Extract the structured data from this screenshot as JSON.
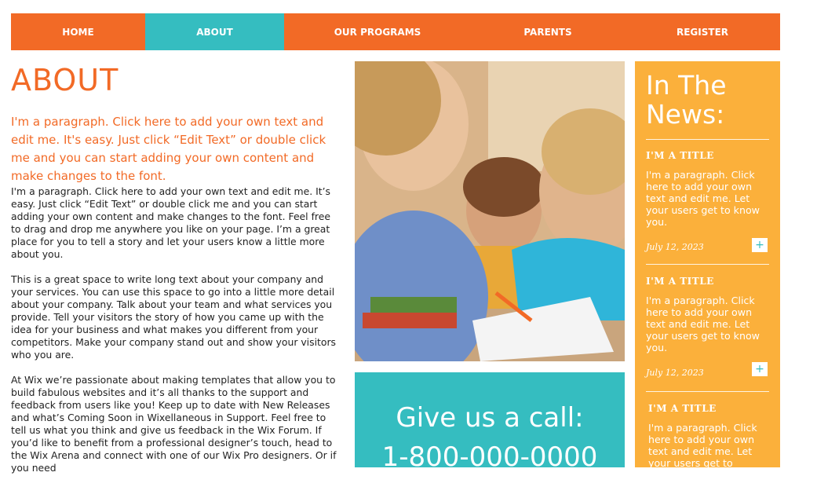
{
  "nav": {
    "items": [
      {
        "label": "HOME",
        "active": false
      },
      {
        "label": "ABOUT",
        "active": true
      },
      {
        "label": "OUR PROGRAMS",
        "active": false
      },
      {
        "label": "PARENTS",
        "active": false
      },
      {
        "label": "REGISTER",
        "active": false
      }
    ]
  },
  "about": {
    "title": "ABOUT",
    "intro": "I'm a paragraph. Click here to add your own text and edit me. It's easy. Just click “Edit Text” or double click me and you can start adding your own content and make changes to the font.",
    "paragraphs": [
      "I'm a paragraph. Click here to add your own text and edit me. It’s easy. Just click “Edit Text” or double click me and you can start adding your own content and make changes to the font. Feel free to drag and drop me anywhere you like on your page. I’m a great place for you to tell a story and let your users know a little more about you.",
      "This is a great space to write long text about your company and your services. You can use this space to go into a little more detail about your company. Talk about your team and what services you provide. Tell your visitors the story of how you came up with the idea for your business and what makes you different from your competitors. Make your company stand out and show your visitors who you are.",
      "At Wix we’re passionate about making templates that allow you to build fabulous websites and it’s all thanks to the support and feedback from users like you! Keep up to date with New Releases and what’s Coming Soon in Wixellaneous in Support. Feel free to tell us what you think and give us feedback in the Wix Forum. If you’d like to benefit from a professional designer’s touch, head to the Wix Arena and connect with one of our Wix Pro designers. Or if you need"
    ]
  },
  "call": {
    "title": "Give us a call:",
    "phone": "1-800-000-0000"
  },
  "news": {
    "title": "In The News:",
    "items": [
      {
        "title": "I'M A TITLE",
        "text": "I'm a paragraph. Click here to add your own text and edit me. Let your users get to know you.",
        "date": "July 12, 2023"
      },
      {
        "title": "I'M A TITLE",
        "text": "I'm a paragraph. Click here to add your own text and edit me. Let your users get to know you.",
        "date": "July 12, 2023"
      },
      {
        "title": "I'M A TITLE",
        "text": "I'm a paragraph. Click here to add your own text and edit me. Let your users get to"
      }
    ],
    "more_symbol": "+"
  },
  "colors": {
    "orange": "#f26a26",
    "teal": "#35bdc0",
    "yellow": "#fbb03b"
  }
}
